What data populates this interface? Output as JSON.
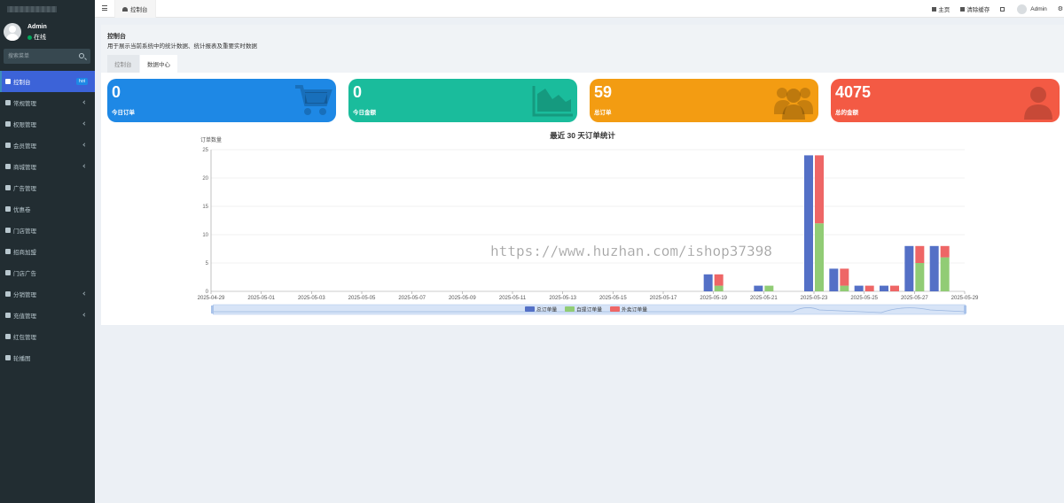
{
  "sidebar": {
    "user": {
      "name": "Admin",
      "status": "在线"
    },
    "search_placeholder": "搜索菜单",
    "items": [
      {
        "label": "控制台",
        "badge": "hot",
        "icon": "dashboard-icon"
      },
      {
        "label": "常规管理",
        "icon": "cogs-icon"
      },
      {
        "label": "权限管理",
        "icon": "group-icon"
      },
      {
        "label": "会员管理",
        "icon": "user-circle-icon"
      },
      {
        "label": "商城管理",
        "icon": "shop-icon"
      },
      {
        "label": "广告管理",
        "icon": "ad-icon"
      },
      {
        "label": "优惠卷",
        "icon": "coupon-icon"
      },
      {
        "label": "门店管理",
        "icon": "store-icon"
      },
      {
        "label": "招商加盟",
        "icon": "franchise-icon"
      },
      {
        "label": "门店广告",
        "icon": "grid-icon"
      },
      {
        "label": "分销管理",
        "icon": "distribution-icon"
      },
      {
        "label": "充值管理",
        "icon": "bookmark-icon"
      },
      {
        "label": "红包管理",
        "icon": "envelope-icon"
      },
      {
        "label": "轮播图",
        "icon": "image-icon"
      }
    ]
  },
  "topnav": {
    "tab_label": "控制台",
    "home": "主页",
    "clear_cache": "清除缓存",
    "admin": "Admin"
  },
  "page": {
    "title": "控制台",
    "description": "用于展示当前系统中的统计数据、统计报表及重要实时数据",
    "tabs": [
      "控制台",
      "数据中心"
    ]
  },
  "cards": [
    {
      "value": "0",
      "label": "今日订单",
      "color": "#1e88e5",
      "icon": "cart-icon"
    },
    {
      "value": "0",
      "label": "今日金额",
      "color": "#1abc9c",
      "icon": "area-chart-icon"
    },
    {
      "value": "59",
      "label": "总订单",
      "color": "#f39c12",
      "icon": "users-icon"
    },
    {
      "value": "4075",
      "label": "总的金额",
      "color": "#f35a44",
      "icon": "user-icon"
    }
  ],
  "watermark": "https://www.huzhan.com/ishop37398",
  "chart_data": {
    "type": "bar",
    "title": "最近 30 天订单统计",
    "ylabel": "订单数量",
    "ylim": [
      0,
      25
    ],
    "yticks": [
      0,
      5,
      10,
      15,
      20,
      25
    ],
    "xtick_labels": [
      "2025-04-29",
      "2025-05-01",
      "2025-05-03",
      "2025-05-05",
      "2025-05-07",
      "2025-05-09",
      "2025-05-11",
      "2025-05-13",
      "2025-05-15",
      "2025-05-17",
      "2025-05-19",
      "2025-05-21",
      "2025-05-23",
      "2025-05-25",
      "2025-05-27",
      "2025-05-29"
    ],
    "categories": [
      "2025-04-29",
      "2025-04-30",
      "2025-05-01",
      "2025-05-02",
      "2025-05-03",
      "2025-05-04",
      "2025-05-05",
      "2025-05-06",
      "2025-05-07",
      "2025-05-08",
      "2025-05-09",
      "2025-05-10",
      "2025-05-11",
      "2025-05-12",
      "2025-05-13",
      "2025-05-14",
      "2025-05-15",
      "2025-05-16",
      "2025-05-17",
      "2025-05-18",
      "2025-05-19",
      "2025-05-20",
      "2025-05-21",
      "2025-05-22",
      "2025-05-23",
      "2025-05-24",
      "2025-05-25",
      "2025-05-26",
      "2025-05-27",
      "2025-05-28",
      "2025-05-29"
    ],
    "series": [
      {
        "name": "总订单量",
        "color": "#5470c6",
        "values": [
          0,
          0,
          0,
          0,
          0,
          0,
          0,
          0,
          0,
          0,
          0,
          0,
          0,
          0,
          0,
          0,
          0,
          0,
          0,
          0,
          3,
          0,
          1,
          0,
          24,
          4,
          1,
          1,
          8,
          8,
          0
        ]
      },
      {
        "name": "自提订单量",
        "color": "#91cc75",
        "values": [
          0,
          0,
          0,
          0,
          0,
          0,
          0,
          0,
          0,
          0,
          0,
          0,
          0,
          0,
          0,
          0,
          0,
          0,
          0,
          0,
          1,
          0,
          1,
          0,
          12,
          1,
          0,
          0,
          5,
          6,
          0
        ]
      },
      {
        "name": "外卖订单量",
        "color": "#ee6666",
        "values": [
          0,
          0,
          0,
          0,
          0,
          0,
          0,
          0,
          0,
          0,
          0,
          0,
          0,
          0,
          0,
          0,
          0,
          0,
          0,
          0,
          2,
          0,
          0,
          0,
          12,
          3,
          1,
          1,
          3,
          2,
          0
        ]
      }
    ],
    "stacked": [
      false,
      true,
      true
    ],
    "legend": "bottom-center",
    "grid": true
  }
}
